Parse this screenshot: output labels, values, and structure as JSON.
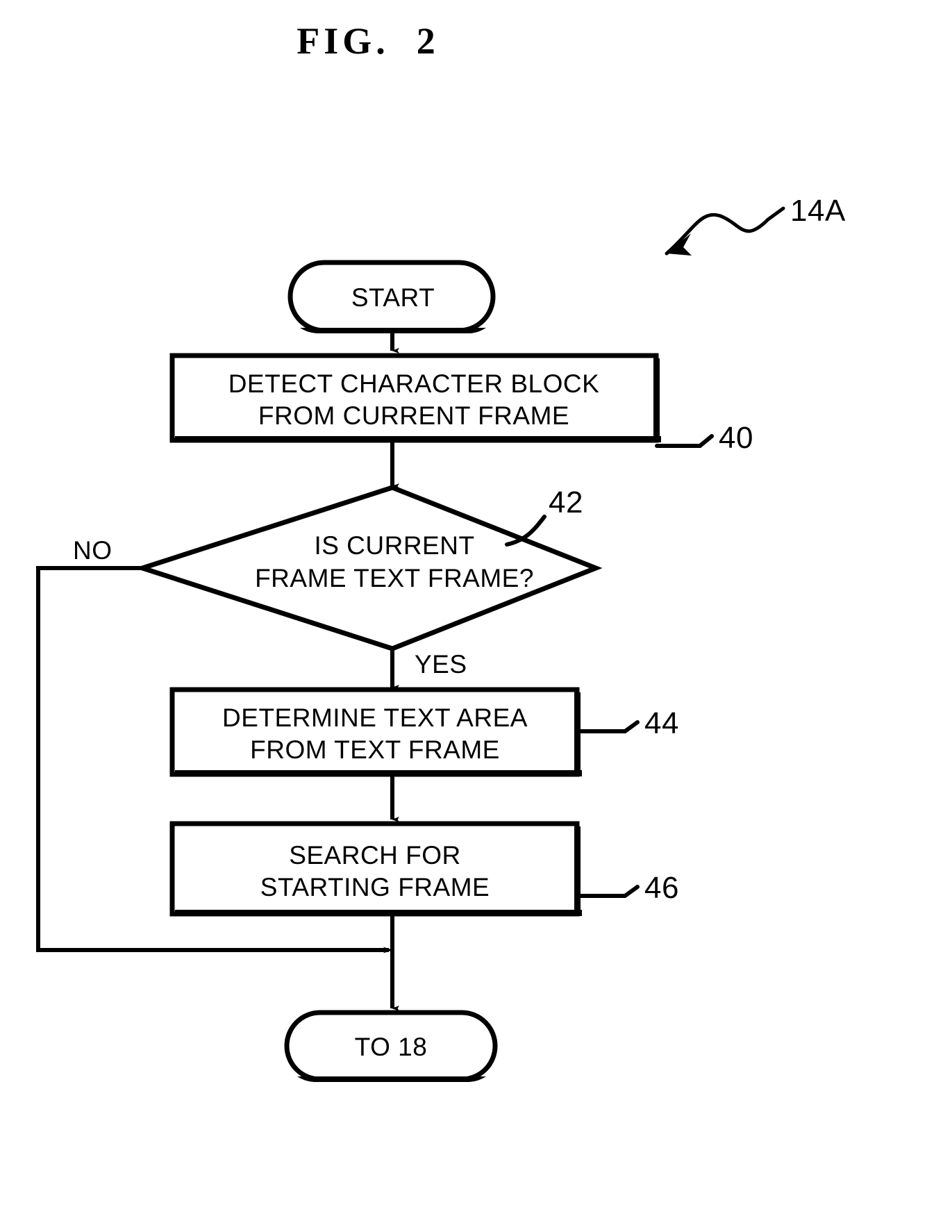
{
  "figure": {
    "title": "FIG.  2",
    "overall_ref": "14A"
  },
  "nodes": {
    "start": {
      "type": "terminator",
      "label": "START"
    },
    "step40": {
      "type": "process",
      "ref": "40",
      "line1": "DETECT CHARACTER BLOCK",
      "line2": "FROM CURRENT FRAME"
    },
    "decision42": {
      "type": "decision",
      "ref": "42",
      "line1": "IS CURRENT",
      "line2": "FRAME TEXT FRAME?"
    },
    "step44": {
      "type": "process",
      "ref": "44",
      "line1": "DETERMINE TEXT AREA",
      "line2": "FROM TEXT FRAME"
    },
    "step46": {
      "type": "process",
      "ref": "46",
      "line1": "SEARCH FOR",
      "line2": "STARTING FRAME"
    },
    "end": {
      "type": "terminator",
      "label": "TO 18"
    }
  },
  "edges": {
    "no_label": "NO",
    "yes_label": "YES"
  },
  "colors": {
    "ink": "#000000",
    "paper": "#ffffff"
  }
}
